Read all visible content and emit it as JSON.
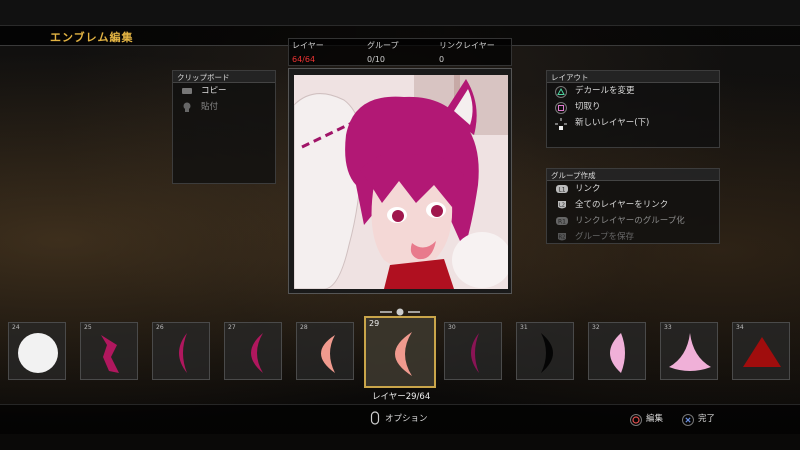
{
  "screen": {
    "title": "エンブレム編集"
  },
  "stats": {
    "layers_label": "レイヤー",
    "layers_value": "64/64",
    "groups_label": "グループ",
    "groups_value": "0/10",
    "links_label": "リンクレイヤー",
    "links_value": "0"
  },
  "clipboard": {
    "header": "クリップボード",
    "items": [
      {
        "label": "コピー",
        "icon": "touchpad-icon",
        "enabled": true
      },
      {
        "label": "貼付",
        "icon": "paste-icon",
        "enabled": false
      }
    ]
  },
  "layout_panel": {
    "header": "レイアウト",
    "items": [
      {
        "label": "デカールを変更",
        "icon": "triangle-button-icon"
      },
      {
        "label": "切取り",
        "icon": "square-button-icon"
      },
      {
        "label": "新しいレイヤー(下)",
        "icon": "dpad-down-icon"
      }
    ]
  },
  "group_panel": {
    "header": "グループ作成",
    "items": [
      {
        "label": "リンク",
        "icon": "l1-button-icon",
        "enabled": true
      },
      {
        "label": "全てのレイヤーをリンク",
        "icon": "l2-button-icon",
        "enabled": true
      },
      {
        "label": "リンクレイヤーのグループ化",
        "icon": "r1-button-icon",
        "enabled": false
      },
      {
        "label": "グループを保存",
        "icon": "r2-button-icon",
        "enabled": false
      }
    ]
  },
  "layers": [
    {
      "num": "24",
      "shape": "circle",
      "color": "#f2f2f2"
    },
    {
      "num": "25",
      "shape": "zigzag",
      "color": "#b0175e"
    },
    {
      "num": "26",
      "shape": "thin-crescent",
      "color": "#b0175e"
    },
    {
      "num": "27",
      "shape": "crescent",
      "color": "#b0175e"
    },
    {
      "num": "28",
      "shape": "crescent",
      "color": "#f09a8e"
    },
    {
      "num": "29",
      "shape": "crescent",
      "color": "#f09a8e",
      "selected": true
    },
    {
      "num": "30",
      "shape": "thin-crescent",
      "color": "#8a1455"
    },
    {
      "num": "31",
      "shape": "half-moon",
      "color": "#050505"
    },
    {
      "num": "32",
      "shape": "half-moon-left",
      "color": "#f0b0d8"
    },
    {
      "num": "33",
      "shape": "drop",
      "color": "#f0b0d8"
    },
    {
      "num": "34",
      "shape": "triangle",
      "color": "#a00d0d"
    }
  ],
  "selection": {
    "label": "レイヤー29/64"
  },
  "footer": {
    "options_label": "オプション",
    "edit_label": "編集",
    "done_label": "完了"
  },
  "colors": {
    "accent": "#e2b343",
    "selection_border": "#c9a54a",
    "counter_red": "#e33333"
  }
}
